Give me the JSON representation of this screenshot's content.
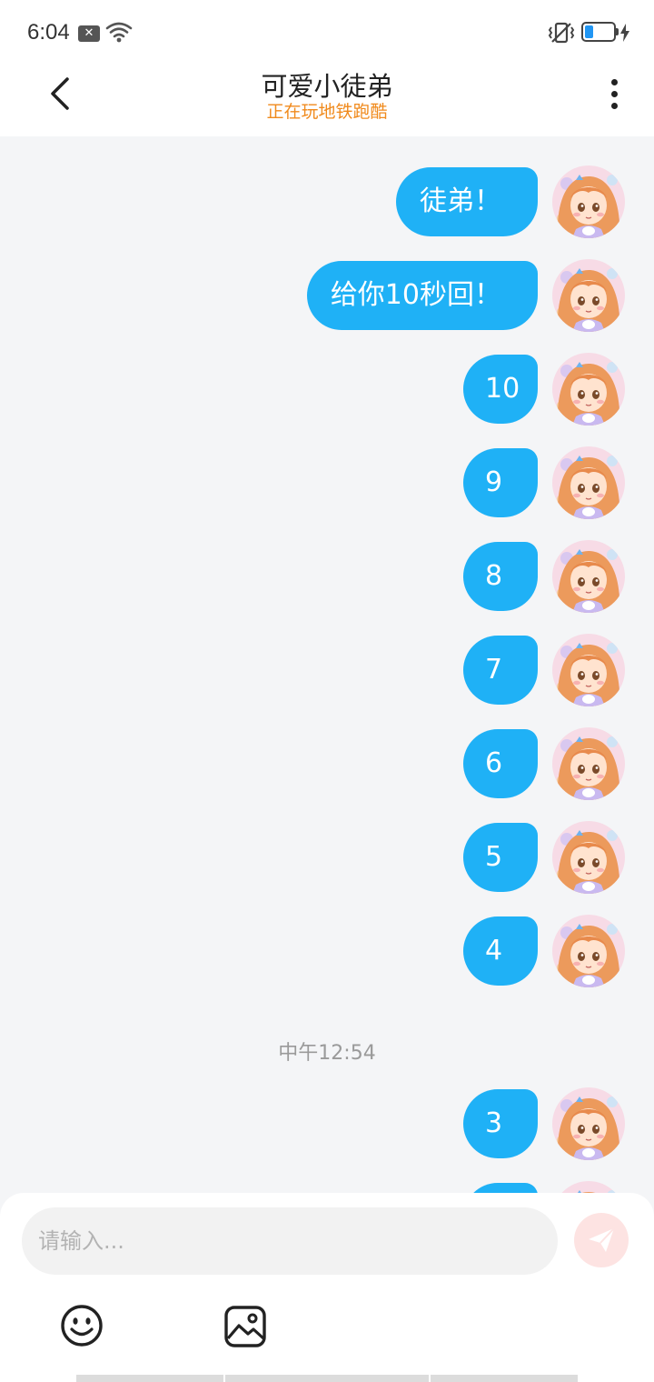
{
  "status_bar": {
    "time": "6:04",
    "battery_level": 0.3,
    "icons": [
      "notification-x-icon",
      "wifi-icon",
      "vibrate-icon",
      "battery-icon",
      "charging-icon"
    ]
  },
  "header": {
    "back_icon": "chevron-left-icon",
    "title": "可爱小徒弟",
    "subtitle": "正在玩地铁跑酷",
    "more_icon": "more-vertical-icon"
  },
  "chat": {
    "messages": [
      {
        "text": "徒弟！"
      },
      {
        "text": "给你10秒回！"
      },
      {
        "text": "10"
      },
      {
        "text": "9"
      },
      {
        "text": "8"
      },
      {
        "text": "7"
      },
      {
        "text": "6"
      },
      {
        "text": "5"
      },
      {
        "text": "4"
      },
      {
        "text": "3"
      }
    ],
    "timestamp": "中午12:54"
  },
  "input": {
    "placeholder": "请输入...",
    "send_icon": "paper-plane-icon",
    "emoji_icon": "smiley-icon",
    "image_icon": "image-icon"
  },
  "colors": {
    "bubble": "#1fb1f6",
    "subtitle": "#f08a1c",
    "background": "#f4f5f7",
    "send_button": "#fde3e2"
  }
}
